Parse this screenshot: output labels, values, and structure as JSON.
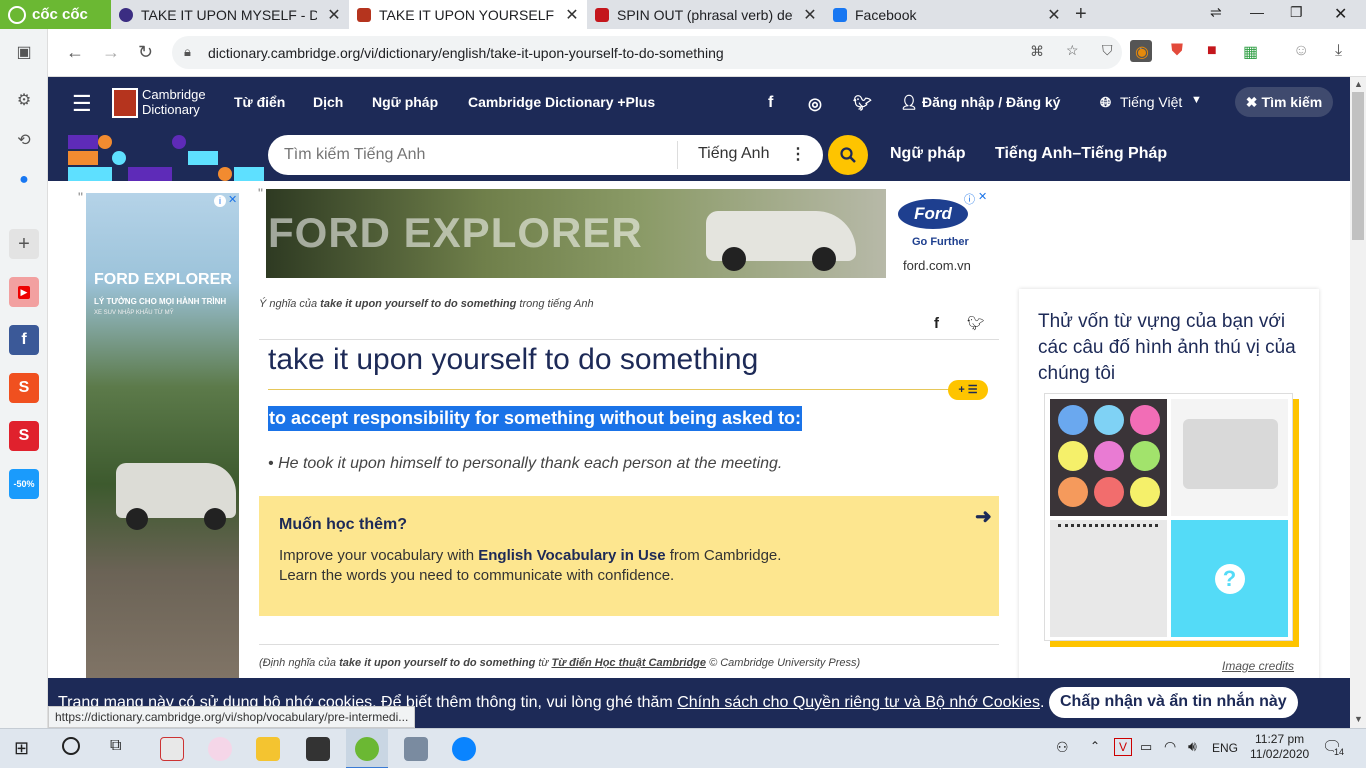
{
  "browser": {
    "brand": "cốc cốc",
    "tabs": [
      {
        "title": "TAKE IT UPON MYSELF - Dic",
        "icon": "cambridge-tab-icon"
      },
      {
        "title": "TAKE IT UPON YOURSELF TO",
        "icon": "cambridge-tab-icon"
      },
      {
        "title": "SPIN OUT (phrasal verb) defin",
        "icon": "macmillan-tab-icon"
      },
      {
        "title": "Facebook",
        "icon": "facebook-tab-icon"
      }
    ],
    "url": "dictionary.cambridge.org/vi/dictionary/english/take-it-upon-yourself-to-do-something",
    "status_url": "https://dictionary.cambridge.org/vi/shop/vocabulary/pre-intermedi..."
  },
  "site": {
    "logo_line1": "Cambridge",
    "logo_line2": "Dictionary",
    "nav": {
      "dictionary": "Từ điển",
      "translate": "Dịch",
      "grammar": "Ngữ pháp",
      "plus": "Cambridge Dictionary +Plus",
      "login": "Đăng nhập / Đăng ký",
      "language": "Tiếng Việt",
      "search_toggle": "Tìm kiếm"
    },
    "search": {
      "placeholder": "Tìm kiếm Tiếng Anh",
      "dict_select": "Tiếng Anh"
    },
    "sub_links": {
      "grammar": "Ngữ pháp",
      "en_fr": "Tiếng Anh–Tiếng Pháp"
    }
  },
  "ads": {
    "left_title": "FORD EXPLORER",
    "left_sub": "LÝ TƯỞNG CHO MỌI HÀNH TRÌNH",
    "left_sub2": "XE SUV NHẬP KHẨU TỪ MỸ",
    "top_title": "FORD EXPLORER",
    "top_brand": "Ford",
    "top_tagline": "Go Further",
    "top_domain": "ford.com.vn",
    "quote_mark": "\""
  },
  "entry": {
    "breadcrumb_pre": "Ý nghĩa của",
    "breadcrumb_term": "take it upon yourself to do something",
    "breadcrumb_post": "trong tiếng Anh",
    "headword": "take it upon yourself to do something",
    "definition": "to accept responsibility for something without being asked to:",
    "example": "He took it upon himself to personally thank each person at the meeting.",
    "add_button": "+ ☰"
  },
  "learn_more": {
    "title": "Muốn học thêm?",
    "line1_pre": "Improve your vocabulary with",
    "line1_bold": "English Vocabulary in Use",
    "line1_post": "from Cambridge.",
    "line2": "Learn the words you need to communicate with confidence."
  },
  "source": {
    "pre": "(Định nghĩa của",
    "term": "take it upon yourself to do something",
    "mid": "từ",
    "dict": "Từ điển Học thuật Cambridge",
    "post": "© Cambridge University Press)"
  },
  "quiz": {
    "title": "Thử vốn từ vựng của bạn với các câu đố hình ảnh thú vị của chúng tôi",
    "credits": "Image credits",
    "question_mark": "?"
  },
  "cookie": {
    "text": "Trang mạng này có sử dụng bộ nhớ cookies. Để biết thêm thông tin, vui lòng ghé thăm",
    "link": "Chính sách cho Quyền riêng tư và Bộ nhớ Cookies",
    "period": ".",
    "accept": "Chấp nhận và ẩn tin nhắn này"
  },
  "taskbar": {
    "lang": "ENG",
    "time": "11:27 pm",
    "date": "11/02/2020",
    "notif_count": "14"
  },
  "colors": {
    "navy": "#1d2a57",
    "yellow": "#fec400",
    "highlight": "#1a73e8",
    "learn_bg": "#fde68f",
    "coccoc_green": "#6bb833"
  }
}
